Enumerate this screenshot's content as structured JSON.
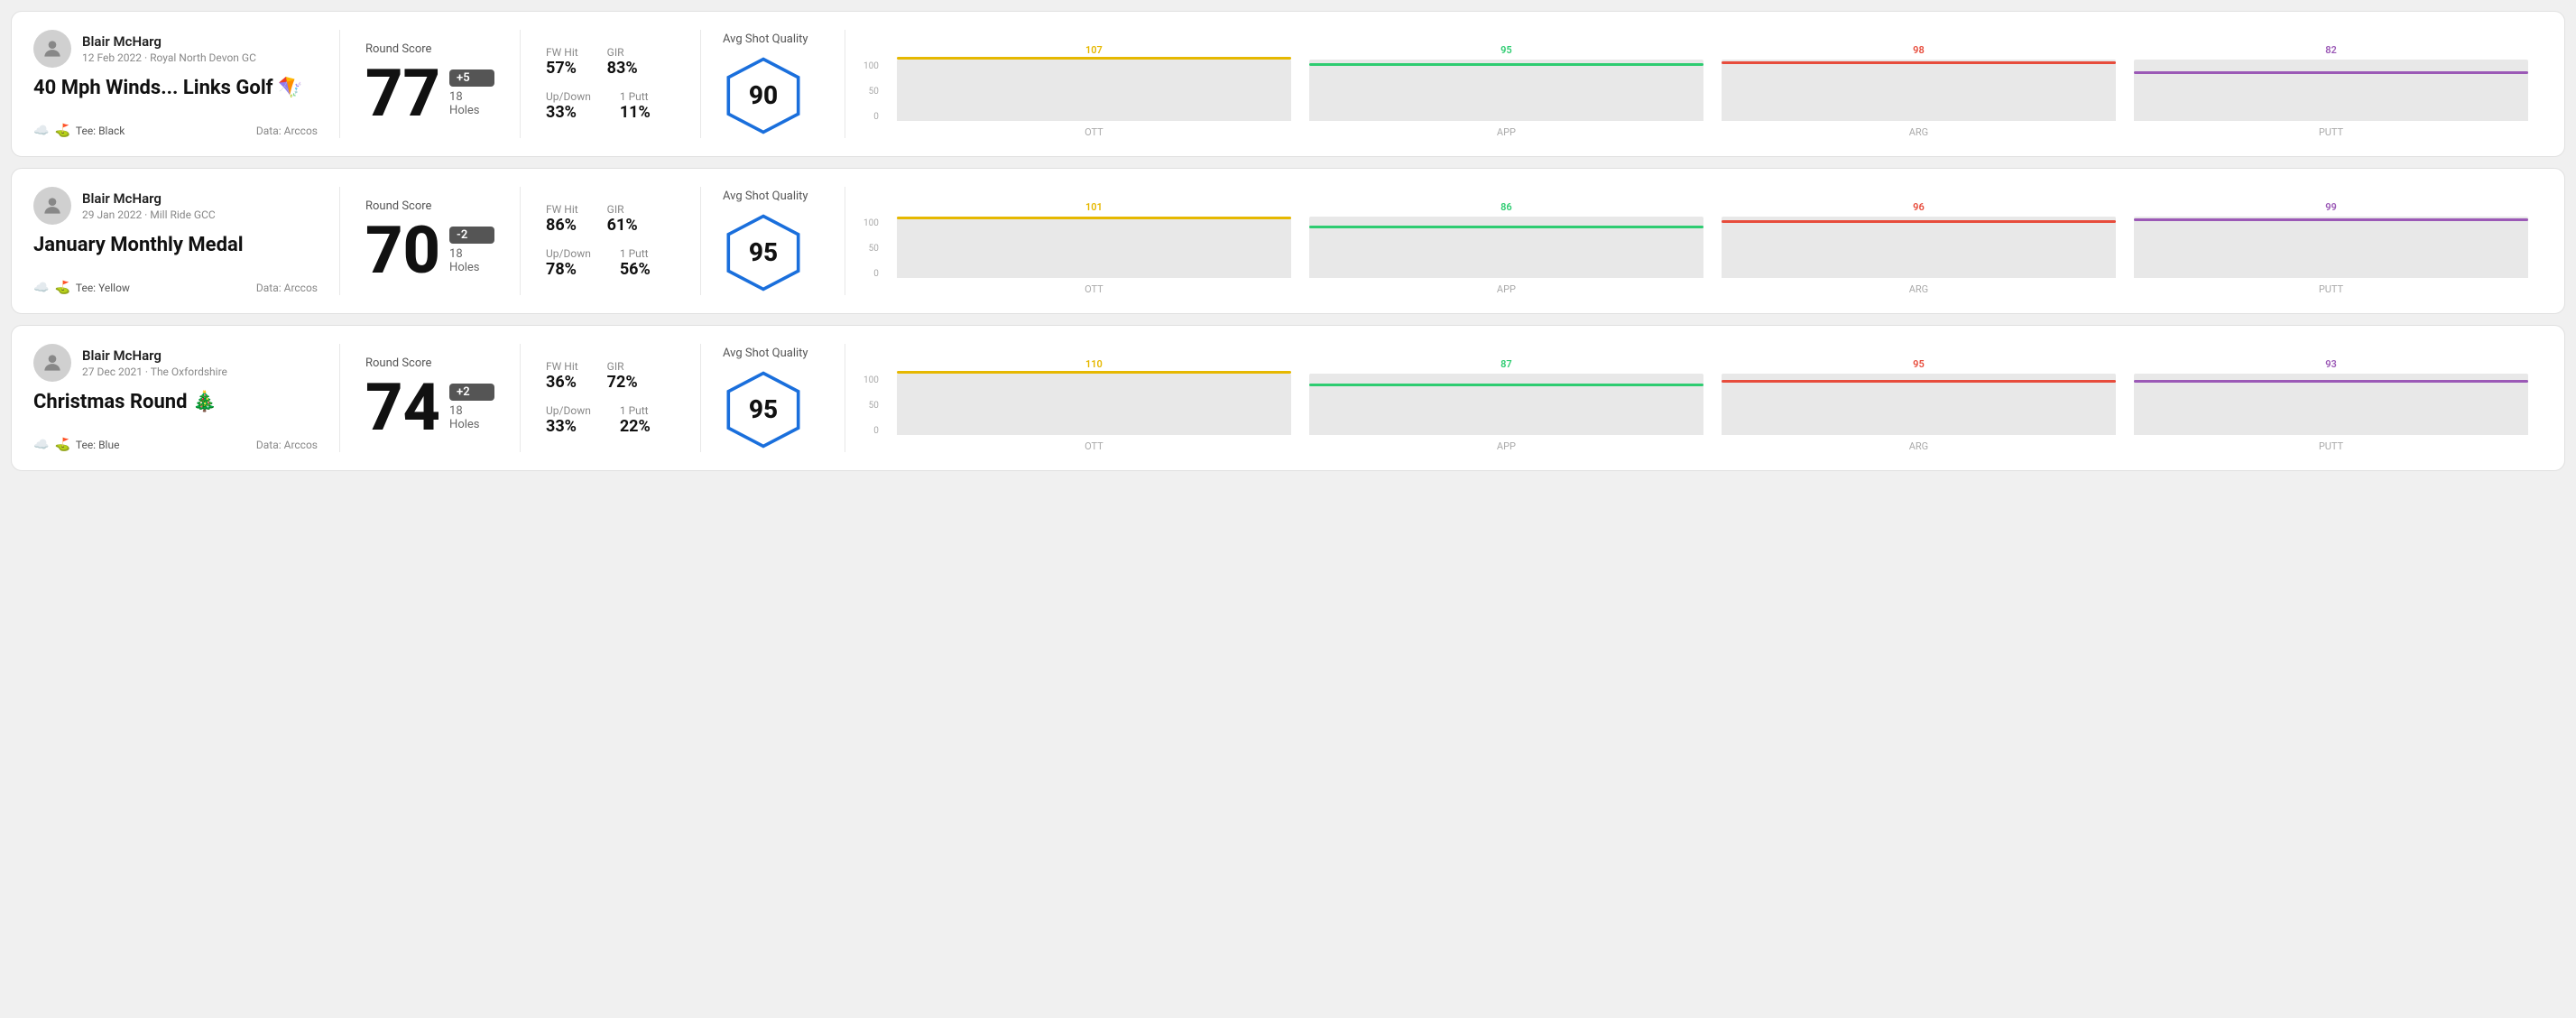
{
  "rounds": [
    {
      "id": "round-1",
      "player": "Blair McHarg",
      "date": "12 Feb 2022 · Royal North Devon GC",
      "title": "40 Mph Winds... Links Golf 🪁",
      "tee": "Black",
      "data_source": "Data: Arccos",
      "score": "77",
      "score_diff": "+5",
      "score_diff_type": "over",
      "holes": "18 Holes",
      "fw_hit": "57%",
      "gir": "83%",
      "up_down": "33%",
      "one_putt": "11%",
      "avg_quality": "90",
      "chart": {
        "ott": {
          "value": 107,
          "pct": 100
        },
        "app": {
          "value": 95,
          "pct": 89
        },
        "arg": {
          "value": 98,
          "pct": 92
        },
        "putt": {
          "value": 82,
          "pct": 77
        }
      }
    },
    {
      "id": "round-2",
      "player": "Blair McHarg",
      "date": "29 Jan 2022 · Mill Ride GCC",
      "title": "January Monthly Medal",
      "tee": "Yellow",
      "data_source": "Data: Arccos",
      "score": "70",
      "score_diff": "-2",
      "score_diff_type": "under",
      "holes": "18 Holes",
      "fw_hit": "86%",
      "gir": "61%",
      "up_down": "78%",
      "one_putt": "56%",
      "avg_quality": "95",
      "chart": {
        "ott": {
          "value": 101,
          "pct": 95
        },
        "app": {
          "value": 86,
          "pct": 81
        },
        "arg": {
          "value": 96,
          "pct": 90
        },
        "putt": {
          "value": 99,
          "pct": 93
        }
      }
    },
    {
      "id": "round-3",
      "player": "Blair McHarg",
      "date": "27 Dec 2021 · The Oxfordshire",
      "title": "Christmas Round 🎄",
      "tee": "Blue",
      "data_source": "Data: Arccos",
      "score": "74",
      "score_diff": "+2",
      "score_diff_type": "over",
      "holes": "18 Holes",
      "fw_hit": "36%",
      "gir": "72%",
      "up_down": "33%",
      "one_putt": "22%",
      "avg_quality": "95",
      "chart": {
        "ott": {
          "value": 110,
          "pct": 100
        },
        "app": {
          "value": 87,
          "pct": 79
        },
        "arg": {
          "value": 95,
          "pct": 86
        },
        "putt": {
          "value": 93,
          "pct": 85
        }
      }
    }
  ],
  "labels": {
    "round_score": "Round Score",
    "fw_hit": "FW Hit",
    "gir": "GIR",
    "up_down": "Up/Down",
    "one_putt": "1 Putt",
    "avg_shot_quality": "Avg Shot Quality",
    "ott": "OTT",
    "app": "APP",
    "arg": "ARG",
    "putt": "PUTT",
    "y100": "100",
    "y50": "50",
    "y0": "0",
    "tee_prefix": "Tee:"
  }
}
